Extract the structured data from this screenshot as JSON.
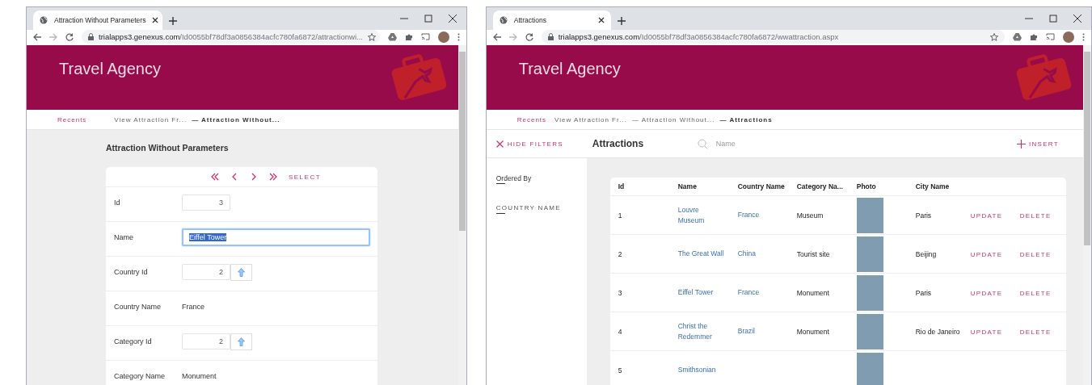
{
  "left_window": {
    "tab_title": "Attraction Without Parameters",
    "url_host": "trialapps3.genexus.com",
    "url_path": "/Id0055bf78df3a0856384acfc780fa6872/attractionwi...",
    "header_title": "Travel Agency",
    "breadcrumb": [
      {
        "label": "Recents",
        "kind": "home"
      },
      {
        "label": "View Attraction Fr...",
        "kind": "link"
      },
      {
        "label": "— Attraction Without...",
        "kind": "current"
      }
    ],
    "form_title": "Attraction Without Parameters",
    "nav_action": "SELECT",
    "fields": [
      {
        "label": "Id",
        "kind": "number",
        "value": "3"
      },
      {
        "label": "Name",
        "kind": "text",
        "value": "Eiffel Tower",
        "focused": true
      },
      {
        "label": "Country Id",
        "kind": "prompt",
        "value": "2"
      },
      {
        "label": "Country Name",
        "kind": "readonly",
        "value": "France"
      },
      {
        "label": "Category Id",
        "kind": "prompt",
        "value": "2"
      },
      {
        "label": "Category Name",
        "kind": "readonly",
        "value": "Monument"
      }
    ]
  },
  "right_window": {
    "tab_title": "Attractions",
    "url_host": "trialapps3.genexus.com",
    "url_path": "/Id0055bf78df3a0856384acfc780fa6872/wwattraction.aspx",
    "header_title": "Travel Agency",
    "breadcrumb": [
      {
        "label": "Recents",
        "kind": "home"
      },
      {
        "label": "View Attraction Fr...",
        "kind": "link"
      },
      {
        "label": "— Attraction Without...",
        "kind": "link"
      },
      {
        "label": "— Attractions",
        "kind": "current"
      }
    ],
    "hide_filters": "HIDE FILTERS",
    "grid_title": "Attractions",
    "search": {
      "placeholder": "Name"
    },
    "insert": "INSERT",
    "ordered_by": "Ordered By",
    "order_option": "COUNTRY NAME",
    "table": {
      "columns": [
        "Id",
        "Name",
        "Country Name",
        "Category Na...",
        "Photo",
        "City Name"
      ],
      "rows": [
        {
          "id": "1",
          "name": "Louvre Museum",
          "country": "France",
          "category": "Museum",
          "city": "Paris",
          "update": "UPDATE",
          "delete": "DELETE"
        },
        {
          "id": "2",
          "name": "The Great Wall",
          "country": "China",
          "category": "Tourist site",
          "city": "Beijing",
          "update": "UPDATE",
          "delete": "DELETE"
        },
        {
          "id": "3",
          "name": "Eiffel Tower",
          "country": "France",
          "category": "Monument",
          "city": "Paris",
          "update": "UPDATE",
          "delete": "DELETE"
        },
        {
          "id": "4",
          "name": "Christ the Redemmer",
          "country": "Brazil",
          "category": "Monument",
          "city": "Rio de Janeiro",
          "update": "UPDATE",
          "delete": "DELETE"
        },
        {
          "id": "5",
          "name": "Smithsonian"
        }
      ]
    }
  }
}
